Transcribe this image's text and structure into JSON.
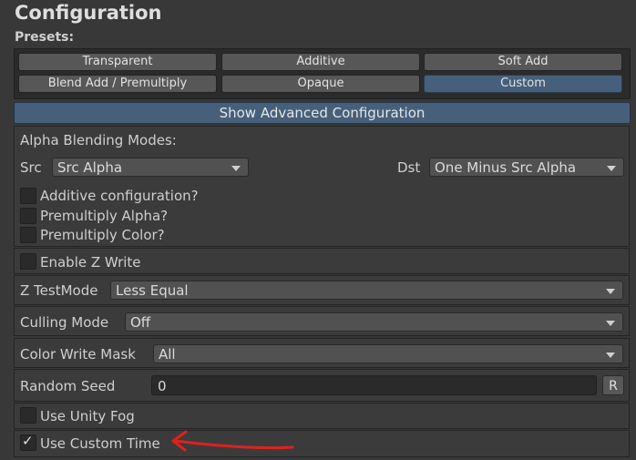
{
  "header": {
    "title": "Configuration",
    "presets_label": "Presets:"
  },
  "presets": [
    {
      "label": "Transparent",
      "selected": false
    },
    {
      "label": "Additive",
      "selected": false
    },
    {
      "label": "Soft Add",
      "selected": false
    },
    {
      "label": "Blend Add / Premultiply",
      "selected": false
    },
    {
      "label": "Opaque",
      "selected": false
    },
    {
      "label": "Custom",
      "selected": true
    }
  ],
  "advanced_button": "Show Advanced Configuration",
  "alpha_blending": {
    "heading": "Alpha Blending Modes:",
    "src_label": "Src",
    "src_value": "Src Alpha",
    "dst_label": "Dst",
    "dst_value": "One Minus Src Alpha",
    "options": [
      {
        "label": "Additive configuration?",
        "checked": false
      },
      {
        "label": "Premultiply Alpha?",
        "checked": false
      },
      {
        "label": "Premultiply Color?",
        "checked": false
      }
    ]
  },
  "z_write": {
    "label": "Enable Z Write",
    "checked": false
  },
  "z_test": {
    "label": "Z TestMode",
    "value": "Less Equal"
  },
  "culling": {
    "label": "Culling Mode",
    "value": "Off"
  },
  "color_mask": {
    "label": "Color Write Mask",
    "value": "All"
  },
  "random_seed": {
    "label": "Random Seed",
    "value": "0",
    "reset_label": "R"
  },
  "unity_fog": {
    "label": "Use Unity Fog",
    "checked": false
  },
  "custom_time": {
    "label": "Use Custom Time",
    "checked": true
  },
  "colors": {
    "accent": "#46607c",
    "annotation": "#e02020"
  }
}
